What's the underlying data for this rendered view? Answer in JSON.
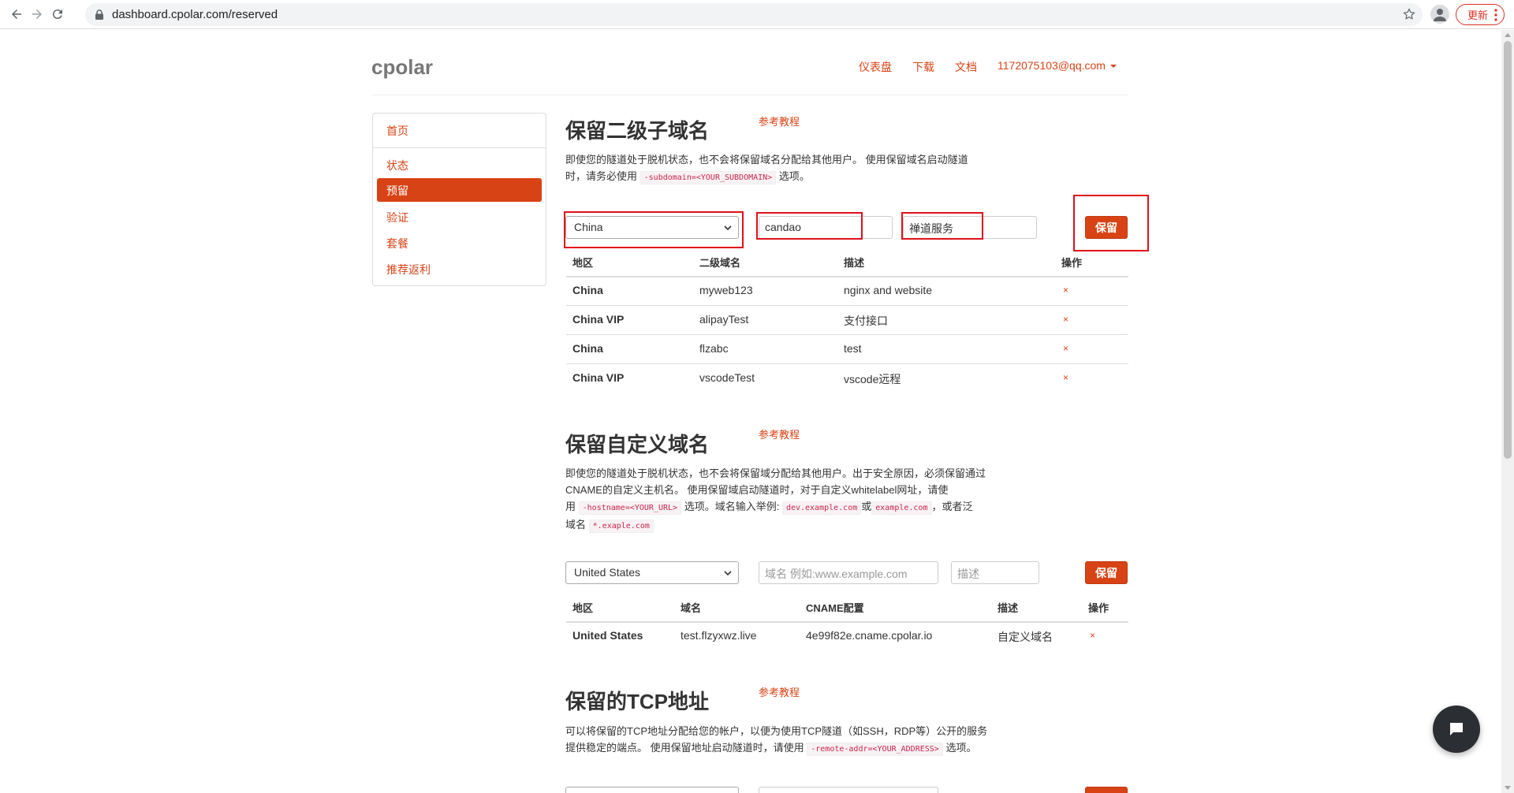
{
  "browser": {
    "url": "dashboard.cpolar.com/reserved",
    "update_label": "更新"
  },
  "header": {
    "brand": "cpolar",
    "nav": [
      "仪表盘",
      "下载",
      "文档"
    ],
    "user": "1172075103@qq.com"
  },
  "sidebar": {
    "items": [
      "首页",
      "状态",
      "预留",
      "验证",
      "套餐",
      "推荐返利"
    ],
    "active": "预留"
  },
  "subdomain_section": {
    "title": "保留二级子域名",
    "tutorial": "参考教程",
    "desc_1": "即使您的隧道处于脱机状态，也不会将保留域名分配给其他用户。 使用保留域名启动隧道",
    "desc_2a": "时，请务必使用",
    "desc_code": "-subdomain=<YOUR_SUBDOMAIN>",
    "desc_2b": "选项。",
    "form": {
      "region": "China",
      "subdomain_value": "candao",
      "desc_value": "禅道服务",
      "save_label": "保留"
    },
    "columns": [
      "地区",
      "二级域名",
      "描述",
      "操作"
    ],
    "rows": [
      {
        "region": "China",
        "name": "myweb123",
        "desc": "nginx and website",
        "action": "×"
      },
      {
        "region": "China VIP",
        "name": "alipayTest",
        "desc": "支付接口",
        "action": "×"
      },
      {
        "region": "China",
        "name": "flzabc",
        "desc": "test",
        "action": "×"
      },
      {
        "region": "China VIP",
        "name": "vscodeTest",
        "desc": "vscode远程",
        "action": "×"
      }
    ]
  },
  "custom_section": {
    "title": "保留自定义域名",
    "tutorial": "参考教程",
    "desc_1": "即使您的隧道处于脱机状态，也不会将保留域分配给其他用户。出于安全原因，必须保留通过",
    "desc_2": "CNAME的自定义主机名。 使用保留域启动隧道时，对于自定义whitelabel网址，请使",
    "desc_3a": "用",
    "desc_code_1": "-hostname=<YOUR_URL>",
    "desc_3b": "选项。域名输入举例:",
    "desc_code_2": "dev.example.com",
    "desc_3c": "或",
    "desc_code_3": "example.com",
    "desc_3d": "，或者泛",
    "desc_4a": "域名",
    "desc_code_4": "*.exaple.com",
    "form": {
      "region": "United States",
      "domain_placeholder": "域名 例如:www.example.com",
      "desc_placeholder": "描述",
      "save_label": "保留"
    },
    "columns": [
      "地区",
      "域名",
      "CNAME配置",
      "描述",
      "操作"
    ],
    "rows": [
      {
        "region": "United States",
        "domain": "test.flzyxwz.live",
        "cname": "4e99f82e.cname.cpolar.io",
        "desc": "自定义域名",
        "action": "×"
      }
    ]
  },
  "tcp_section": {
    "title": "保留的TCP地址",
    "tutorial": "参考教程",
    "desc_1": "可以将保留的TCP地址分配给您的帐户，以便为使用TCP隧道（如SSH，RDP等）公开的服务",
    "desc_2a": "提供稳定的端点。 使用保留地址启动隧道时，请使用",
    "desc_code": "-remote-addr=<YOUR_ADDRESS>",
    "desc_2b": "选项。"
  },
  "colors": {
    "accent": "#d84315",
    "highlight_box": "#e0101a",
    "chat_bg": "#2b2f33"
  }
}
